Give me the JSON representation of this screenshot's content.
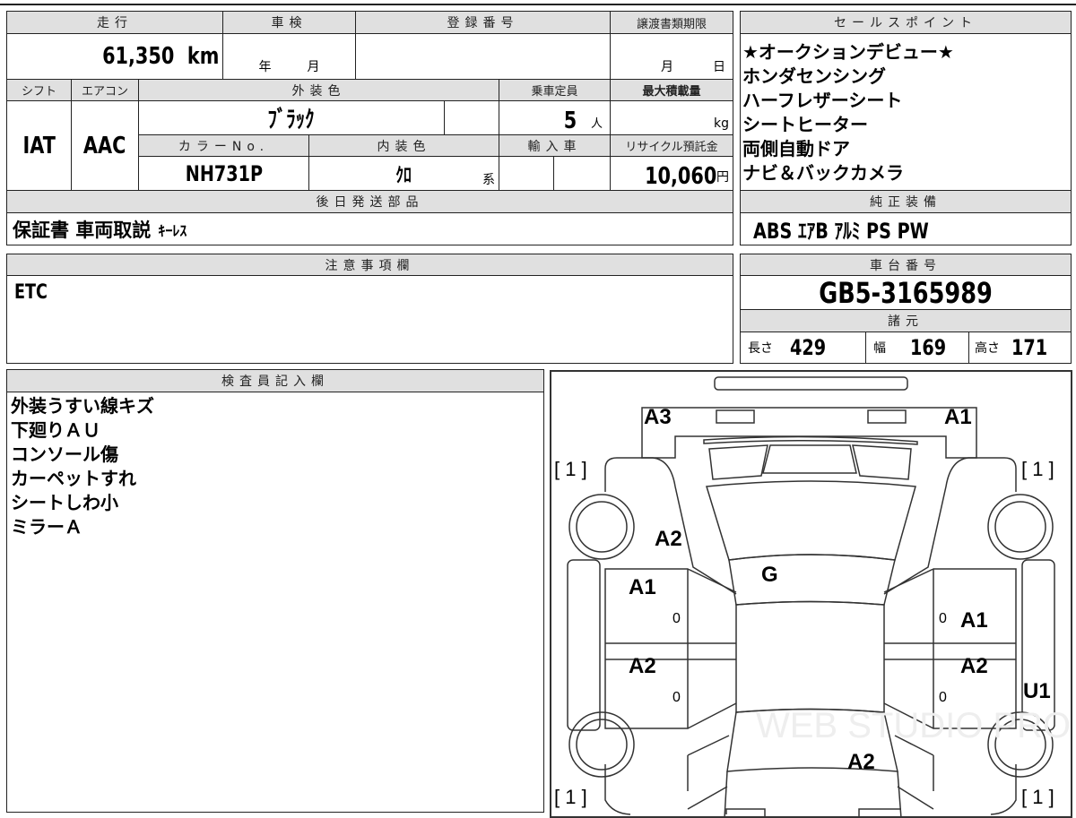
{
  "top": {
    "mileage_label": "走行",
    "mileage": "61,350",
    "mileage_unit": "km",
    "inspection_label": "車検",
    "inspection_year": "年",
    "inspection_month": "月",
    "registration_label": "登録番号",
    "transfer_deadline_label": "譲渡書類期限",
    "transfer_month": "月",
    "transfer_day": "日",
    "shift_label": "シフト",
    "shift": "IAT",
    "ac_label": "エアコン",
    "ac": "AAC",
    "exterior_color_label": "外装色",
    "exterior_color": "ﾌﾞﾗｯｸ",
    "capacity_label": "乗車定員",
    "capacity": "5",
    "capacity_unit": "人",
    "max_load_label": "最大積載量",
    "max_load_unit": "kg",
    "color_no_label": "カラーNo.",
    "color_no": "NH731P",
    "interior_color_label": "内装色",
    "interior_color": "ｸﾛ",
    "interior_suffix": "系",
    "import_label": "輸入車",
    "recycle_label": "リサイクル預託金",
    "recycle_fee": "10,060",
    "recycle_unit": "円",
    "later_parts_label": "後日発送部品",
    "later_parts": "保証書 車両取説",
    "later_parts_small": "ｷｰﾚｽ"
  },
  "sales_points": {
    "label": "セールスポイント",
    "items": [
      "★オークションデビュー★",
      "ホンダセンシング",
      "ハーフレザーシート",
      "シートヒーター",
      "両側自動ドア",
      "ナビ＆バックカメラ"
    ]
  },
  "equipment": {
    "label": "純正装備",
    "value": "ABS ｴｱB ｱﾙﾐ PS PW"
  },
  "notes": {
    "label": "注意事項欄",
    "value": "ETC"
  },
  "chassis": {
    "label": "車台番号",
    "value": "GB5-3165989"
  },
  "specs": {
    "label": "諸元",
    "length_label": "長さ",
    "length": "429",
    "width_label": "幅",
    "width": "169",
    "height_label": "高さ",
    "height": "171"
  },
  "inspector": {
    "label": "検査員記入欄",
    "items": [
      "外装うすい線キズ",
      "下廻りＡＵ",
      "コンソール傷",
      "カーペットすれ",
      "シートしわ小",
      "ミラーＡ"
    ]
  },
  "diagram": {
    "marks": [
      "A3",
      "A1",
      "[ 1 ]",
      "[ 1 ]",
      "A2",
      "G",
      "A1",
      "A1",
      "A2",
      "A2",
      "U1",
      "A2",
      "[ 1 ]",
      "[ 1 ]",
      "0",
      "0",
      "0",
      "0"
    ],
    "watermark": "WEB STUDIO PRO"
  }
}
